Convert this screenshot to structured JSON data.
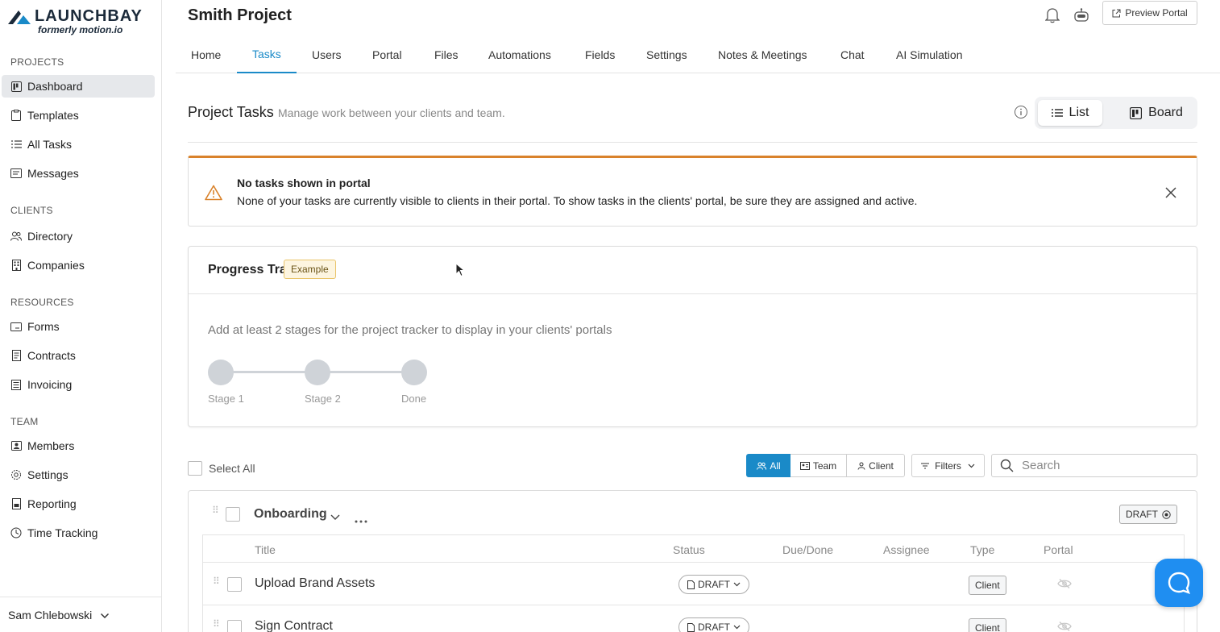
{
  "brand": {
    "name": "LAUNCHBAY",
    "tagline": "formerly motion.io",
    "accent": "#1a8ac8"
  },
  "sidebar": {
    "sections": [
      {
        "label": "PROJECTS",
        "items": [
          {
            "label": "Dashboard",
            "icon": "board-icon",
            "active": true
          },
          {
            "label": "Templates",
            "icon": "clipboard-icon"
          },
          {
            "label": "All Tasks",
            "icon": "list-icon"
          },
          {
            "label": "Messages",
            "icon": "message-icon"
          }
        ]
      },
      {
        "label": "CLIENTS",
        "items": [
          {
            "label": "Directory",
            "icon": "people-icon"
          },
          {
            "label": "Companies",
            "icon": "building-icon"
          }
        ]
      },
      {
        "label": "RESOURCES",
        "items": [
          {
            "label": "Forms",
            "icon": "form-icon"
          },
          {
            "label": "Contracts",
            "icon": "document-icon"
          },
          {
            "label": "Invoicing",
            "icon": "invoice-icon"
          }
        ]
      },
      {
        "label": "TEAM",
        "items": [
          {
            "label": "Members",
            "icon": "member-icon"
          },
          {
            "label": "Settings",
            "icon": "gear-icon"
          },
          {
            "label": "Reporting",
            "icon": "report-icon"
          },
          {
            "label": "Time Tracking",
            "icon": "clock-icon"
          }
        ]
      }
    ],
    "user": "Sam Chlebowski"
  },
  "header": {
    "project_title": "Smith Project",
    "preview_label": "Preview Portal",
    "tabs": [
      "Home",
      "Tasks",
      "Users",
      "Portal",
      "Files",
      "Automations",
      "Fields",
      "Settings",
      "Notes & Meetings",
      "Chat",
      "AI Simulation"
    ],
    "active_tab": "Tasks"
  },
  "tasks_header": {
    "title": "Project Tasks",
    "subtitle": "Manage work between your clients and team.",
    "view_list": "List",
    "view_board": "Board"
  },
  "alert": {
    "title": "No tasks shown in portal",
    "text": "None of your tasks are currently visible to clients in their portal. To show tasks in the clients' portal, be sure they are assigned and active.",
    "color": "#d9822b"
  },
  "tracker": {
    "title": "Progress Tracker",
    "badge": "Example",
    "hint": "Add at least 2 stages for the project tracker to display in your clients' portals",
    "stages": [
      "Stage 1",
      "Stage 2",
      "Done"
    ]
  },
  "toolbar": {
    "select_all": "Select All",
    "filter_all": "All",
    "filter_team": "Team",
    "filter_client": "Client",
    "filters": "Filters",
    "search_placeholder": "Search"
  },
  "group": {
    "name": "Onboarding",
    "status": "DRAFT",
    "columns": [
      "Title",
      "Status",
      "Due/Done",
      "Assignee",
      "Type",
      "Portal"
    ],
    "rows": [
      {
        "title": "Upload Brand Assets",
        "status": "DRAFT",
        "type": "Client"
      },
      {
        "title": "Sign Contract",
        "status": "DRAFT",
        "type": "Client"
      }
    ]
  }
}
